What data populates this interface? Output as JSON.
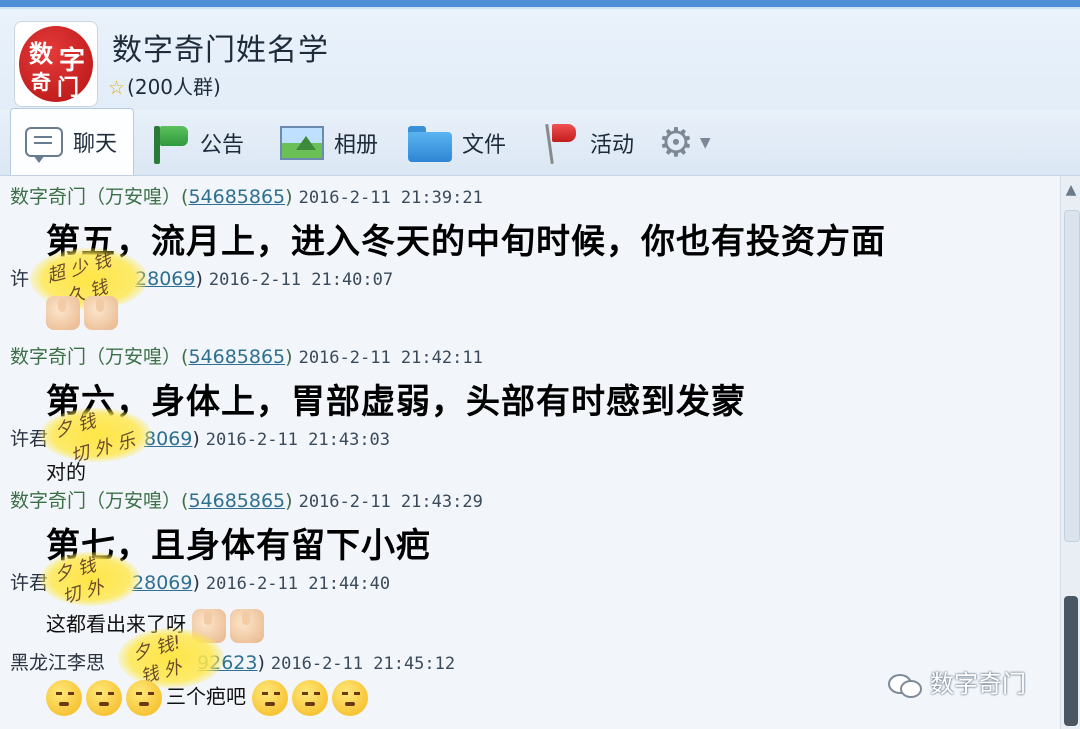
{
  "group": {
    "name": "数字奇门姓名学",
    "member_info": "(200人群)",
    "avatar_text": [
      "数",
      "字",
      "奇",
      "门"
    ]
  },
  "toolbar": {
    "chat_label": "聊天",
    "notice_label": "公告",
    "album_label": "相册",
    "files_label": "文件",
    "activity_label": "活动"
  },
  "messages": [
    {
      "sender": "数字奇门（万安喤）",
      "qq": "54685865",
      "time": "2016-2-11  21:39:21",
      "text": "第五，流月上，进入冬天的中旬时候，你也有投资方面"
    },
    {
      "sender": "许",
      "qq": "28069",
      "time": "2016-2-11  21:40:07",
      "text": ""
    },
    {
      "sender": "数字奇门（万安喤）",
      "qq": "54685865",
      "time": "2016-2-11  21:42:11",
      "text": "第六，身体上，胃部虚弱，头部有时感到发蒙"
    },
    {
      "sender": "许君",
      "qq": "8069",
      "time": "2016-2-11  21:43:03",
      "text": "对的"
    },
    {
      "sender": "数字奇门（万安喤）",
      "qq": "54685865",
      "time": "2016-2-11  21:43:29",
      "text": "第七，且身体有留下小疤"
    },
    {
      "sender": "许君",
      "qq": "28069",
      "time": "2016-2-11  21:44:40",
      "text": "这都看出来了呀"
    },
    {
      "sender": "黑龙江李思",
      "qq": "92623",
      "time": "2016-2-11  21:45:12",
      "text": "三个疤吧"
    }
  ],
  "watermark": "数字奇门",
  "colors": {
    "accent": "#4e8fd8",
    "sender": "#3c6f47",
    "qq_link": "#2f6f92"
  }
}
